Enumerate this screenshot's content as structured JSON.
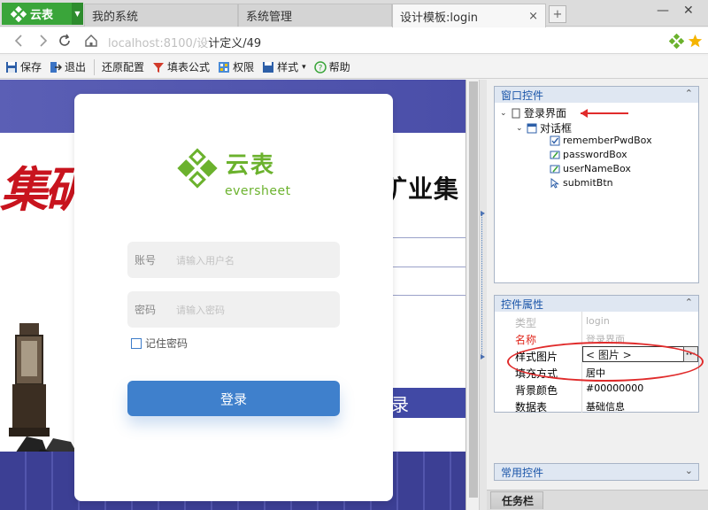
{
  "tabbar": {
    "brand": "云表",
    "tabs": [
      {
        "label": "我的系统"
      },
      {
        "label": "系统管理"
      },
      {
        "label": "设计模板:login"
      }
    ],
    "close_glyph": "×",
    "new_tab_glyph": "+",
    "minimize_glyph": "—",
    "close_window_glyph": "✕"
  },
  "address": {
    "url_host": "localhost:8100/设",
    "url_mid": "计定义",
    "url_tail": "/49"
  },
  "toolbar": {
    "items": [
      {
        "label": "保存",
        "icon": "save-icon"
      },
      {
        "label": "退出",
        "icon": "exit-icon"
      },
      {
        "label": "还原配置",
        "icon": "none"
      },
      {
        "label": "填表公式",
        "icon": "formula-icon"
      },
      {
        "label": "权限",
        "icon": "permission-icon"
      },
      {
        "label": "样式",
        "icon": "style-icon"
      },
      {
        "label": "帮助",
        "icon": "help-icon"
      }
    ]
  },
  "canvas": {
    "bg_heading": "矿业集",
    "bg_red": "集矿",
    "bg_login": "录",
    "card": {
      "logo_cn": "云表",
      "logo_en": "eversheet",
      "account_label": "账号",
      "account_placeholder": "请输入用户名",
      "password_label": "密码",
      "password_placeholder": "请输入密码",
      "remember_label": "记住密码",
      "login_label": "登录"
    }
  },
  "window_controls": {
    "title": "窗口控件",
    "tree": [
      {
        "label": "登录界面",
        "level": 0
      },
      {
        "label": "对话框",
        "level": 1
      },
      {
        "label": "rememberPwdBox",
        "level": 2
      },
      {
        "label": "passwordBox",
        "level": 2
      },
      {
        "label": "userNameBox",
        "level": 2
      },
      {
        "label": "submitBtn",
        "level": 2
      }
    ]
  },
  "properties": {
    "title": "控件属性",
    "rows": [
      {
        "key": "类型",
        "value": "login"
      },
      {
        "key": "名称",
        "value": "登录界面"
      },
      {
        "key": "样式图片",
        "value": "< 图片 >"
      },
      {
        "key": "填充方式",
        "value": "居中"
      },
      {
        "key": "背景颜色",
        "value": "#00000000"
      },
      {
        "key": "数据表",
        "value": "基础信息"
      }
    ],
    "ellipsis_glyph": "···"
  },
  "common_controls": {
    "title": "常用控件"
  },
  "taskbar": {
    "label": "任务栏"
  },
  "colors": {
    "brand_green": "#3aa53a",
    "logo_green": "#6bb22d",
    "login_blue": "#3f80cc",
    "panel_header_text": "#1b56a9",
    "highlight_red": "#e02b2b"
  }
}
